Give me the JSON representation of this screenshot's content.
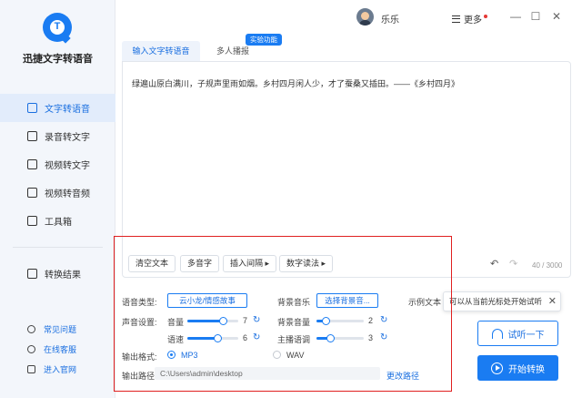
{
  "app": {
    "title": "迅捷文字转语音",
    "username": "乐乐",
    "more_label": "更多",
    "accent_color": "#1a7cf2"
  },
  "sidebar": {
    "items": [
      {
        "label": "文字转语音",
        "icon": "text-to-speech-icon",
        "active": true
      },
      {
        "label": "录音转文字",
        "icon": "recording-icon"
      },
      {
        "label": "视频转文字",
        "icon": "video-icon"
      },
      {
        "label": "视频转音频",
        "icon": "video-audio-icon"
      },
      {
        "label": "工具箱",
        "icon": "toolbox-icon"
      }
    ],
    "results": {
      "label": "转换结果",
      "icon": "result-icon"
    },
    "footer": [
      {
        "label": "常见问题",
        "icon": "question-icon"
      },
      {
        "label": "在线客服",
        "icon": "chat-icon"
      },
      {
        "label": "进入官网",
        "icon": "monitor-icon"
      }
    ]
  },
  "window_controls": {
    "minimize": "—",
    "maximize": "☐",
    "close": "✕"
  },
  "tabs": {
    "input_text": "输入文字转语音",
    "multi_person": "多人播报",
    "badge": "实验功能"
  },
  "editor": {
    "text": "绿遍山原白满川，子规声里雨如烟。乡村四月闲人少，才了蚕桑又插田。——《乡村四月》",
    "buttons": [
      "清空文本",
      "多音字",
      "插入间隔 ▸",
      "数字读法 ▸"
    ],
    "undo": "↶",
    "redo": "↷",
    "counter": "40 / 3000"
  },
  "settings": {
    "voice_type_label": "语音类型:",
    "voice_type_value": "云小龙/情感故事",
    "bg_music_label": "背景音乐",
    "bg_music_value": "选择背景音...",
    "sample_text_label": "示例文本",
    "voice_settings_label": "声音设置:",
    "volume_label": "音量",
    "volume_value": "7",
    "volume_level": 0.7,
    "speed_label": "语速",
    "speed_value": "6",
    "speed_level": 0.6,
    "bg_volume_label": "背景音量",
    "bg_volume_value": "2",
    "bg_volume_level": 0.2,
    "anchor_label": "主播语调",
    "anchor_value": "3",
    "anchor_level": 0.3,
    "format_label": "输出格式:",
    "format_mp3": "MP3",
    "format_wav": "WAV",
    "format_selected": "MP3",
    "path_label": "输出路径:",
    "path_value": "C:\\Users\\admin\\desktop",
    "change_path": "更改路径",
    "refresh_icon": "↻"
  },
  "tooltip": {
    "text": "可以从当前光标处开始试听",
    "close": "✕"
  },
  "actions": {
    "preview": "试听一下",
    "start": "开始转换"
  }
}
